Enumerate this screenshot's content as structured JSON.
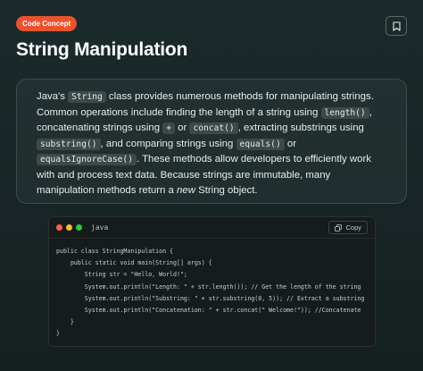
{
  "badge": "Code Concept",
  "title": "String Manipulation",
  "description": {
    "p1": "Java's ",
    "c1": "String",
    "p2": " class provides numerous methods for manipulating strings. Common operations include finding the length of a string using ",
    "c2": "length()",
    "p3": ", concatenating strings using ",
    "c3": "+",
    "p4": " or ",
    "c4": "concat()",
    "p5": ", extracting substrings using ",
    "c5": "substring()",
    "p6": ", and comparing strings using ",
    "c6": "equals()",
    "p7": " or ",
    "c7": "equalsIgnoreCase()",
    "p8": ". These methods allow developers to efficiently work with and process text data. Because strings are immutable, many manipulation methods return a ",
    "em": "new",
    "p9": " String object."
  },
  "code": {
    "language": "java",
    "copy_label": "Copy",
    "lines": [
      "public class StringManipulation {",
      "    public static void main(String[] args) {",
      "        String str = \"Hello, World!\";",
      "        System.out.println(\"Length: \" + str.length()); // Get the length of the string",
      "        System.out.println(\"Substring: \" + str.substring(0, 5)); // Extract a substring",
      "        System.out.println(\"Concatenation: \" + str.concat(\" Welcome!\")); //Concatenate",
      "    }",
      "}"
    ]
  },
  "colors": {
    "badge": "#e8532f",
    "dot_red": "#ff5f56",
    "dot_yellow": "#ffbd2e",
    "dot_green": "#27c93f"
  },
  "icons": {
    "bookmark": "bookmark-icon",
    "copy": "copy-icon"
  }
}
